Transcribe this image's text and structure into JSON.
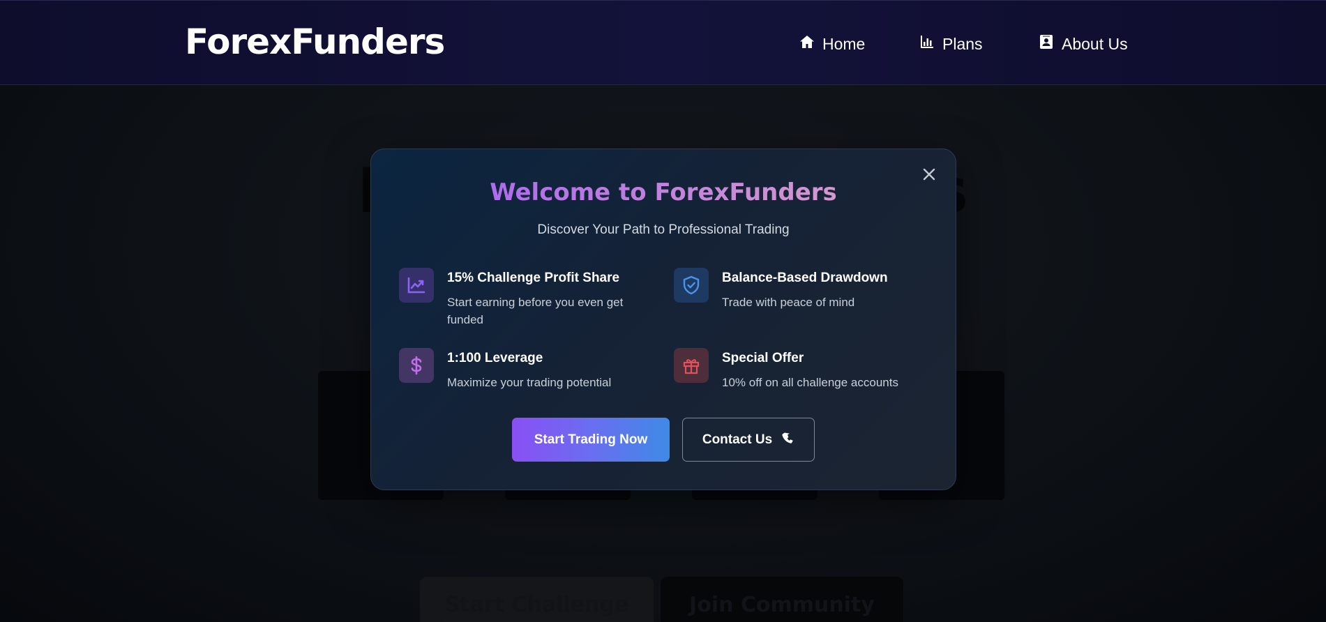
{
  "header": {
    "logo": "ForexFunders",
    "nav": [
      {
        "label": "Home",
        "icon": "home-icon"
      },
      {
        "label": "Plans",
        "icon": "bar-chart-icon"
      },
      {
        "label": "About Us",
        "icon": "contact-card-icon"
      }
    ]
  },
  "background": {
    "hero": "Empower Traders",
    "buttons": [
      "Start Challenge",
      "Join Community"
    ]
  },
  "modal": {
    "title": "Welcome to ForexFunders",
    "subtitle": "Discover Your Path to Professional Trading",
    "close_icon": "close-icon",
    "features": [
      {
        "title": "15% Challenge Profit Share",
        "description": "Start earning before you even get funded",
        "icon": "chart-line-icon",
        "color": "#7c5cf2"
      },
      {
        "title": "Balance-Based Drawdown",
        "description": "Trade with peace of mind",
        "icon": "shield-check-icon",
        "color": "#4a90e2"
      },
      {
        "title": "1:100 Leverage",
        "description": "Maximize your trading potential",
        "icon": "dollar-icon",
        "color": "#b86be8"
      },
      {
        "title": "Special Offer",
        "description": "10% off on all challenge accounts",
        "icon": "gift-icon",
        "color": "#e0505a"
      }
    ],
    "primary_button": "Start Trading Now",
    "secondary_button": "Contact Us",
    "secondary_button_icon": "phone-icon"
  },
  "colors": {
    "header_bg": "#13123a",
    "accent_start": "#8a4ff4",
    "accent_end": "#3f8ae6"
  }
}
